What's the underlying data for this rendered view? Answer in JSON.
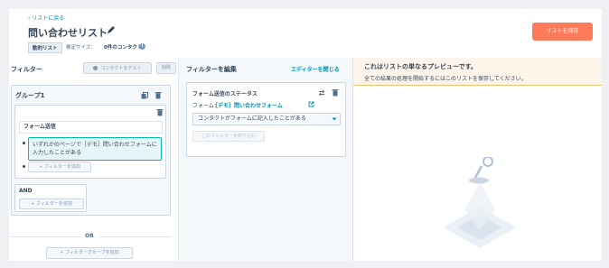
{
  "header": {
    "back_link": "‹ リストに戻る",
    "title": "問い合わせリスト",
    "badge": "動的リスト",
    "size_label": "推定サイズ：",
    "size_value": "0件のコンタクト",
    "save_label": "リストを保存"
  },
  "filters_panel": {
    "title": "フィルター",
    "test_button": "コンタクトをテスト",
    "delete_button": "削除",
    "group_title": "グループ1",
    "filter_type": "フォーム送信",
    "condition_text": "いずれかのページで［デモ］問い合わせフォームに入力したことがある",
    "add_filter_inner": "+ フィルターを追加",
    "and_label": "AND",
    "add_filter_and": "+ フィルターを追加",
    "or_label": "OR",
    "add_group_button": "+ フィルターグループを追加"
  },
  "editor": {
    "title": "フィルターを編集",
    "close_link": "エディターを閉じる",
    "status_title": "フォーム送信のステータス",
    "form_prefix": "フォーム：",
    "form_link": "［デモ］問い合わせフォーム",
    "condition_select": "コンタクトがフォームに記入したことがある",
    "refine_button": "このフィルターを絞り込む"
  },
  "preview": {
    "title": "これはリストの単なるプレビューです。",
    "description": "全ての結果の処理を開始するにはこのリストを保存してください。"
  },
  "colors": {
    "accent": "#ff7a59",
    "link": "#0091ae",
    "teal_border": "#00bda5",
    "banner_bg": "#fef4ea"
  }
}
